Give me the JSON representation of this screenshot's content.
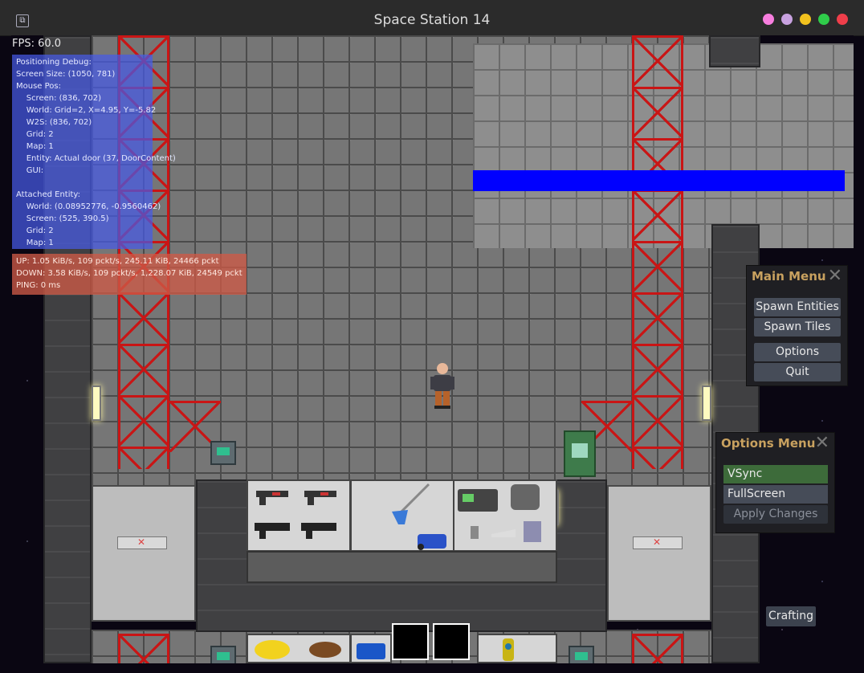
{
  "window": {
    "title": "Space Station 14"
  },
  "hud": {
    "fps": "FPS: 60.0",
    "debug_lines": [
      "Positioning Debug:",
      "Screen Size: (1050, 781)",
      "Mouse Pos:",
      "    Screen: (836, 702)",
      "    World: Grid=2, X=4.95, Y=-5.82",
      "    W2S: (836, 702)",
      "    Grid: 2",
      "    Map: 1",
      "    Entity: Actual door (37, DoorContent)",
      "    GUI:",
      "",
      "Attached Entity:",
      "    World: (0.08952776, -0.9560462)",
      "    Screen: (525, 390.5)",
      "    Grid: 2",
      "    Map: 1"
    ],
    "net_lines": [
      "UP: 1.05 KiB/s, 109 pckt/s, 245.11 KiB, 24466 pckt",
      "DOWN: 3.58 KiB/s, 109 pckt/s, 1,228.07 KiB, 24549 pckt",
      "PING: 0 ms"
    ]
  },
  "main_menu": {
    "title": "Main Menu",
    "buttons": [
      "Spawn Entities",
      "Spawn Tiles",
      "Options",
      "Quit"
    ]
  },
  "options_menu": {
    "title": "Options Menu",
    "vsync": {
      "label": "VSync",
      "checked": true
    },
    "fullscreen": {
      "label": "FullScreen",
      "checked": false
    },
    "apply": "Apply Changes"
  },
  "crafting_button": "Crafting",
  "colors": {
    "accent_title": "#c8a15f",
    "checked_green": "#3d6b3a",
    "girder_red": "#c91515",
    "debug_blue": "#4a5ae6",
    "net_red": "#cd5a46"
  }
}
